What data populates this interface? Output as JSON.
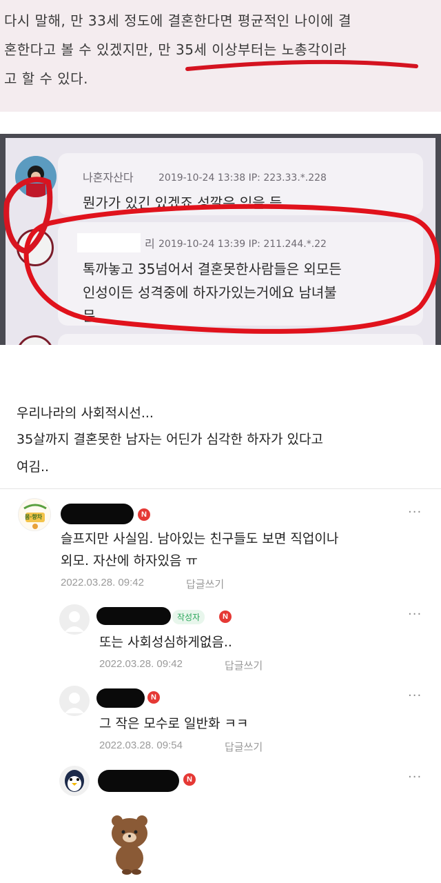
{
  "snippet_top": {
    "line1": "다시 말해, 만 33세 정도에 결혼한다면 평균적인 나이에 결",
    "line2": "혼한다고 볼 수 있겠지만, 만 35세 이상부터는 노총각이라",
    "line3": "고 할 수 있다."
  },
  "snippet_chat": {
    "comment1": {
      "name": "나혼자산다",
      "meta": "2019-10-24 13:38  IP: 223.33.*.228",
      "text": "뭔가가 있긴 있겠죠 성깔은 있을 듯"
    },
    "comment2": {
      "name_suffix": "리",
      "meta": "2019-10-24 13:39  IP: 211.244.*.22",
      "text_line1": "톡까놓고 35넘어서 결혼못한사람들은 외모든",
      "text_line2": "인성이든 성격중에 하자가있는거에요 남녀불",
      "text_line3": "문"
    }
  },
  "caption": {
    "line1": "우리나라의 사회적시선...",
    "line2": "35살까지 결혼못한 남자는 어딘가 심각한 하자가 있다고",
    "line3": "여김.."
  },
  "comments": [
    {
      "avatar_label_1": "몸·향차",
      "badge": "N",
      "more": "···",
      "text_line1": "슬프지만 사실임. 남아있는 친구들도 보면 직업이나",
      "text_line2": "외모. 자산에 하자있음 ㅠ",
      "date": "2022.03.28. 09:42",
      "reply": "답글쓰기"
    },
    {
      "author_badge": "작성자",
      "badge": "N",
      "more": "···",
      "text_line1": "또는 사회성심하게없음..",
      "date": "2022.03.28. 09:42",
      "reply": "답글쓰기"
    },
    {
      "badge": "N",
      "more": "···",
      "text_line1": "그 작은 모수로 일반화 ㅋㅋ",
      "date": "2022.03.28. 09:54",
      "reply": "답글쓰기"
    },
    {
      "badge": "N",
      "more": "···",
      "sticker": "brown-bear-sticker"
    }
  ],
  "colors": {
    "badge_red": "#e53935",
    "highlight_red": "#e0121c",
    "author_green": "#2aa65a"
  }
}
